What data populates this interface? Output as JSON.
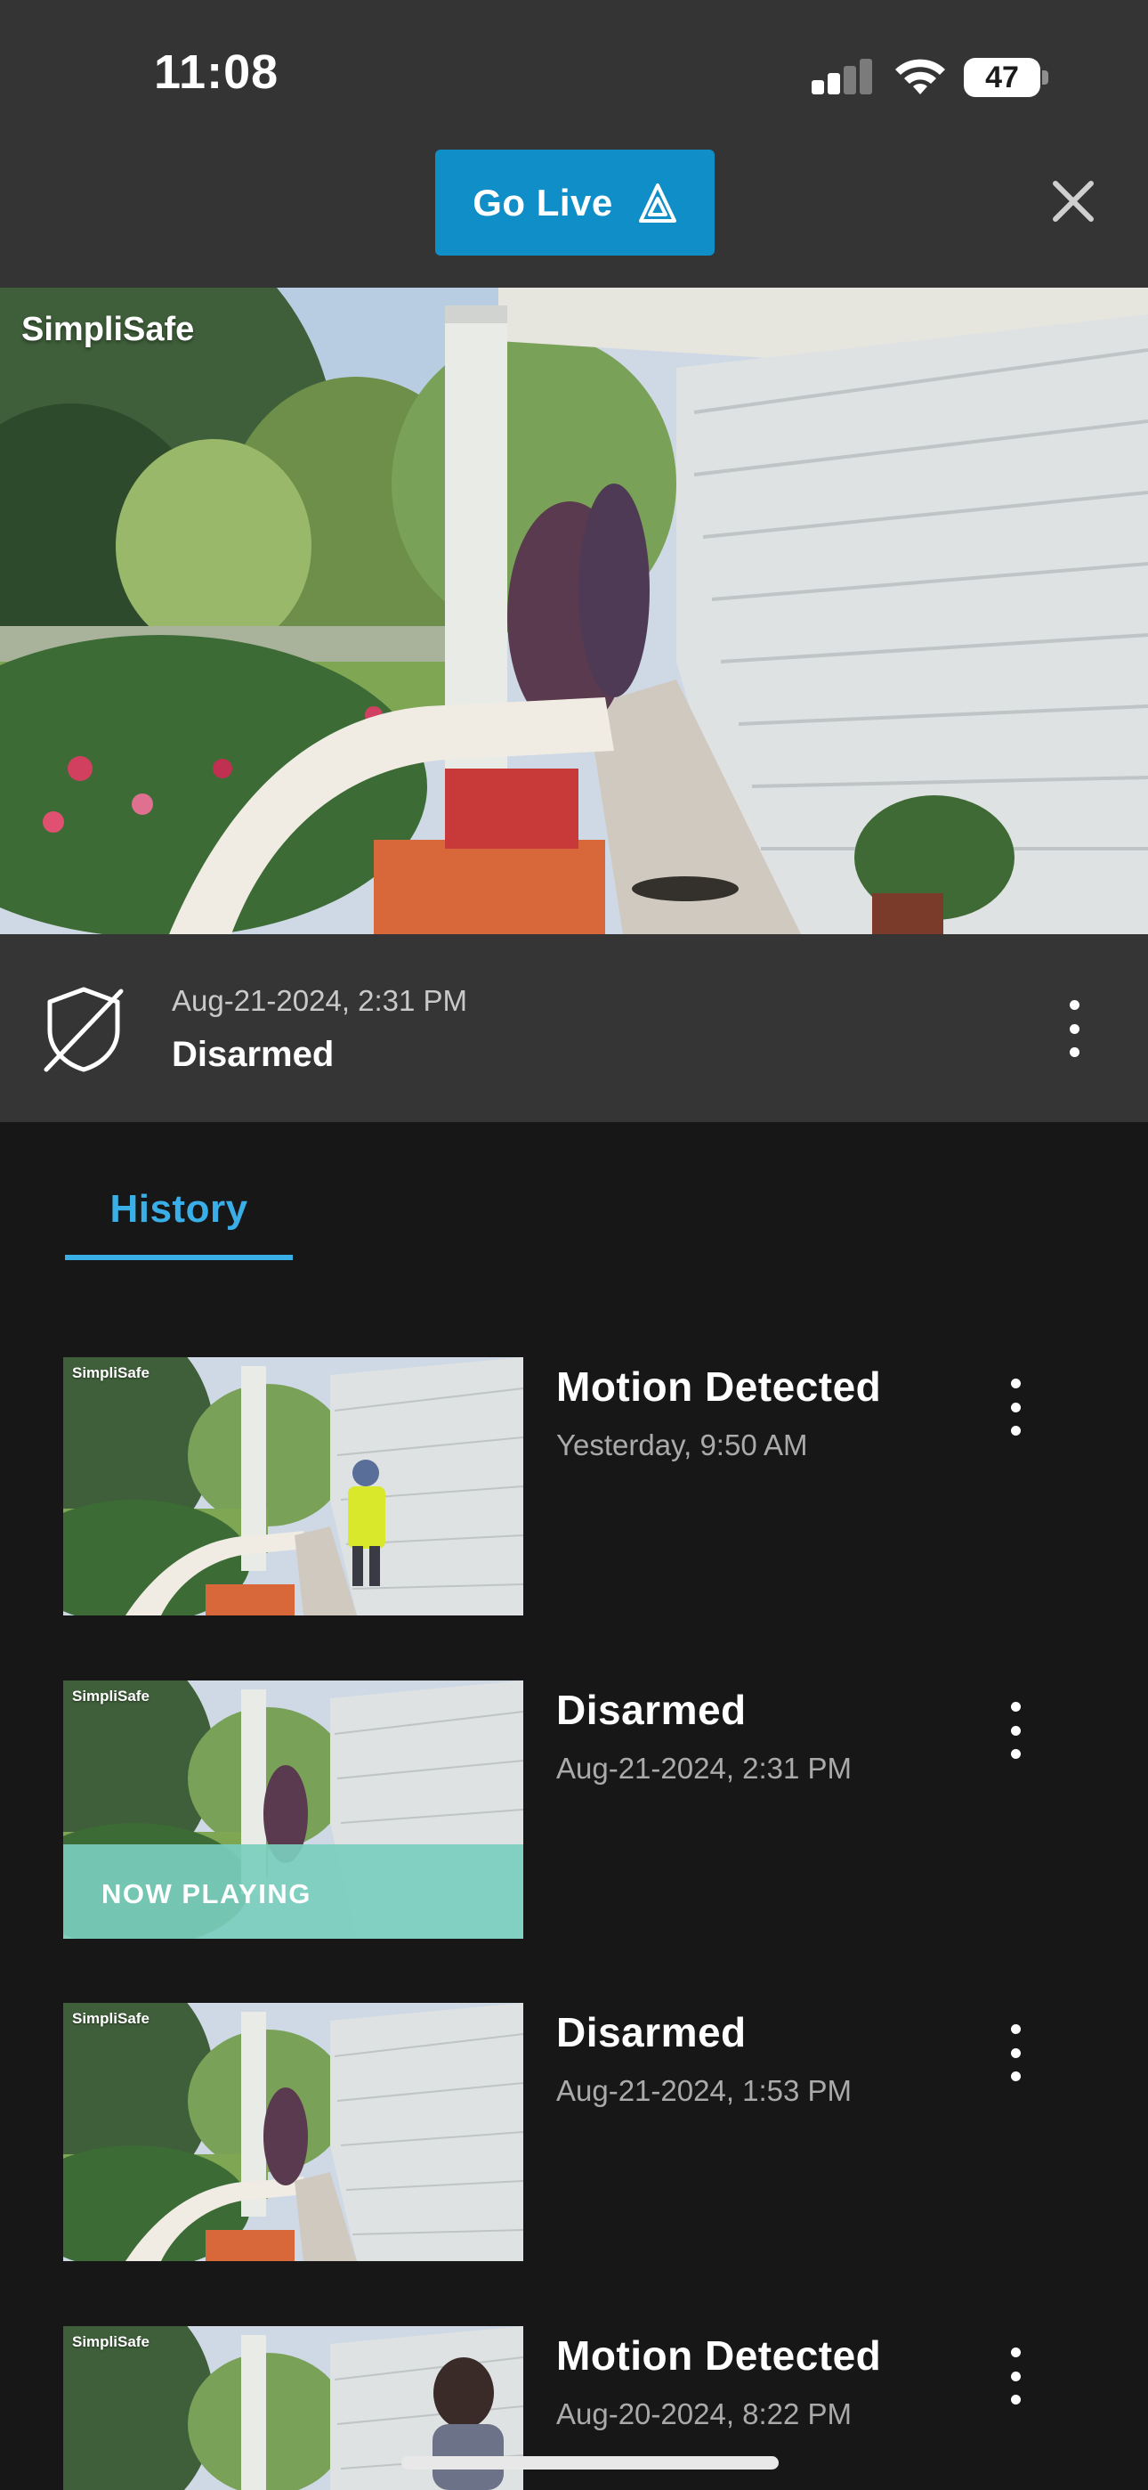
{
  "status_bar": {
    "time": "11:08",
    "battery": "47",
    "icons": [
      "signal-icon",
      "wifi-icon",
      "battery-icon"
    ]
  },
  "header": {
    "go_live_label": "Go Live",
    "go_live_icon": "go-live-arrows-icon",
    "close_icon": "close-icon"
  },
  "camera": {
    "brand_watermark": "SimpliSafe"
  },
  "event": {
    "date": "Aug-21-2024, 2:31 PM",
    "status": "Disarmed",
    "icon": "shield-disarmed-icon"
  },
  "tabs": [
    {
      "label": "History",
      "active": true
    }
  ],
  "history": [
    {
      "title": "Motion Detected",
      "time": "Yesterday, 9:50 AM",
      "now_playing": false,
      "person": "yellow-vest"
    },
    {
      "title": "Disarmed",
      "time": "Aug-21-2024, 2:31 PM",
      "now_playing": true,
      "now_playing_label": "NOW PLAYING"
    },
    {
      "title": "Disarmed",
      "time": "Aug-21-2024, 1:53 PM",
      "now_playing": false
    },
    {
      "title": "Motion Detected",
      "time": "Aug-20-2024, 8:22 PM",
      "now_playing": false,
      "person": "visitor"
    }
  ],
  "thumb_brand": "SimpliSafe",
  "colors": {
    "accent": "#0f8ec8",
    "tab_active": "#3aaee6",
    "now_playing": "#7acebe",
    "background": "#181717",
    "header": "#353434"
  }
}
